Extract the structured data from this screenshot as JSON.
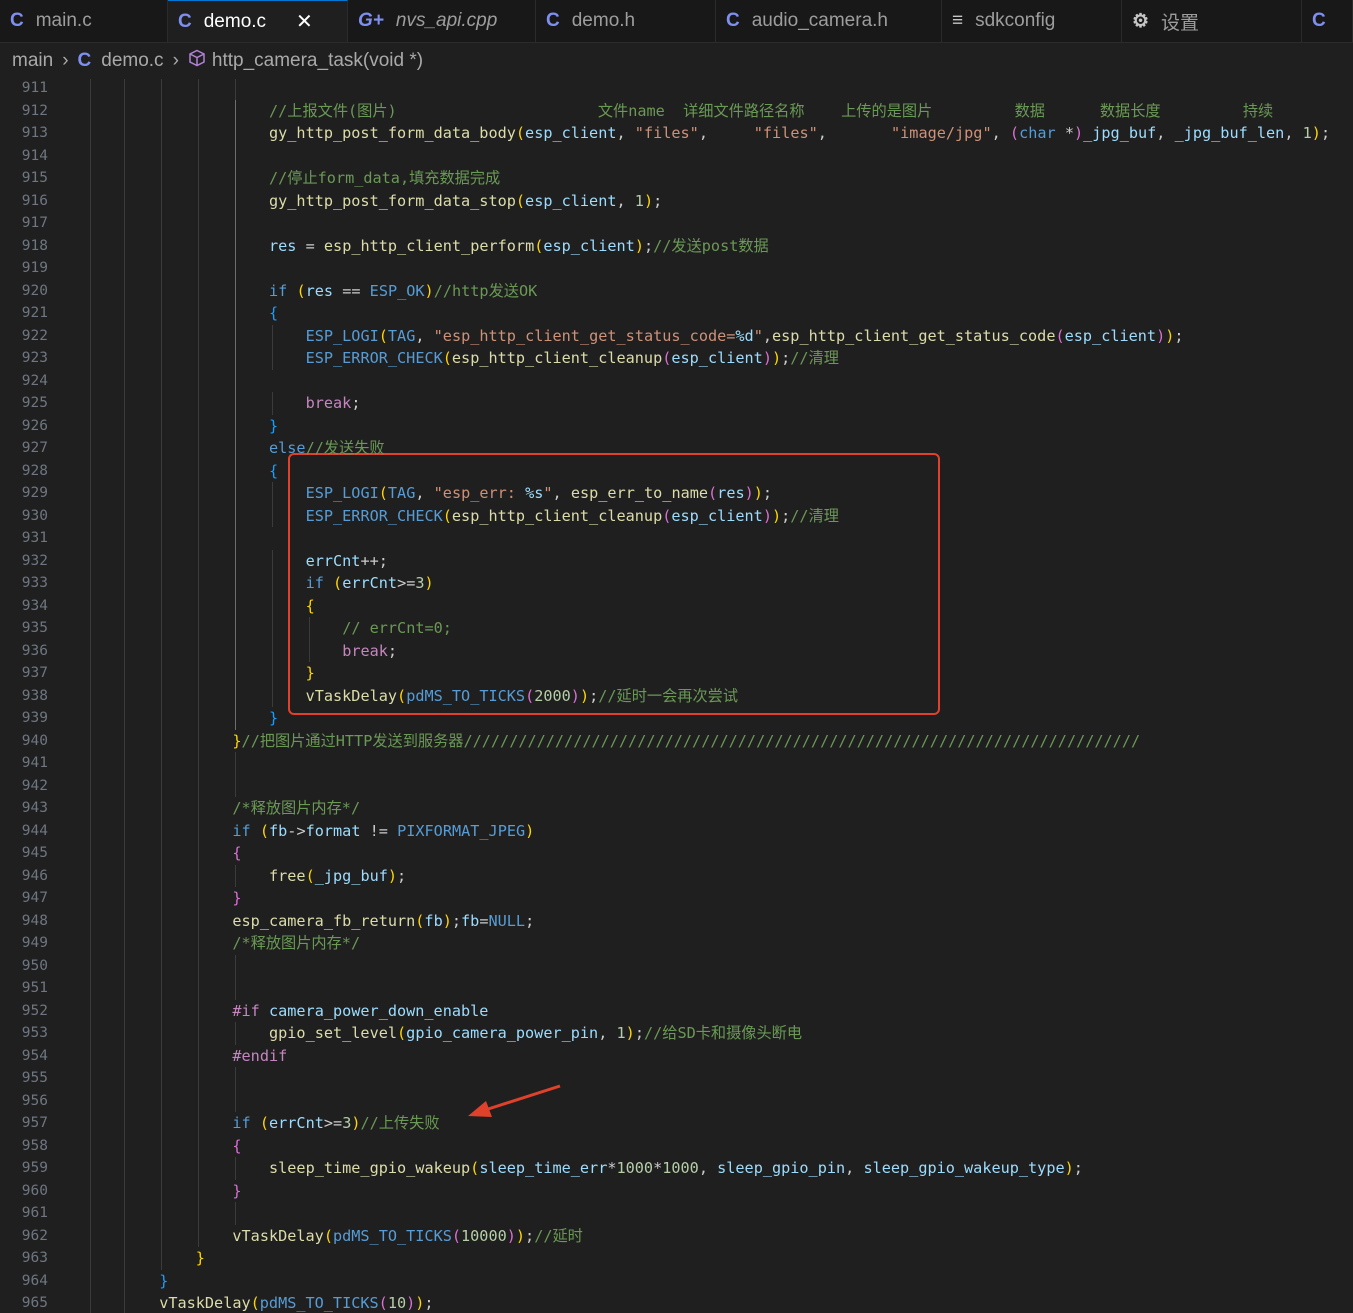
{
  "tabs": [
    {
      "icon": "C",
      "label": "main.c"
    },
    {
      "icon": "C",
      "label": "demo.c"
    },
    {
      "icon": "G+",
      "label": "nvs_api.cpp"
    },
    {
      "icon": "C",
      "label": "demo.h"
    },
    {
      "icon": "C",
      "label": "audio_camera.h"
    },
    {
      "icon": "≡",
      "label": "sdkconfig"
    },
    {
      "icon": "⚙",
      "label": "设置"
    },
    {
      "icon": "C",
      "label": ""
    }
  ],
  "active_tab": "demo.c",
  "breadcrumb": {
    "folder": "main",
    "file": "demo.c",
    "symbol": "http_camera_task(void *)"
  },
  "annotation": {
    "box_color": "#e0412b",
    "arrow_color": "#e0412b"
  },
  "lines": [
    {
      "n": "911",
      "t": ""
    },
    {
      "n": "912",
      "t": "//上报文件(图片)                      文件name  详细文件路径名称    上传的是图片         数据      数据长度         持续"
    },
    {
      "n": "913",
      "t": "gy_http_post_form_data_body(esp_client, \"files\",     \"files\",       \"image/jpg\", (char *)_jpg_buf, _jpg_buf_len, 1);"
    },
    {
      "n": "914",
      "t": ""
    },
    {
      "n": "915",
      "t": "//停止form_data,填充数据完成"
    },
    {
      "n": "916",
      "t": "gy_http_post_form_data_stop(esp_client, 1);"
    },
    {
      "n": "917",
      "t": ""
    },
    {
      "n": "918",
      "t": "res = esp_http_client_perform(esp_client);//发送post数据"
    },
    {
      "n": "919",
      "t": ""
    },
    {
      "n": "920",
      "t": "if (res == ESP_OK)//http发送OK"
    },
    {
      "n": "921",
      "t": "{"
    },
    {
      "n": "922",
      "t": "ESP_LOGI(TAG, \"esp_http_client_get_status_code=%d\",esp_http_client_get_status_code(esp_client));"
    },
    {
      "n": "923",
      "t": "ESP_ERROR_CHECK(esp_http_client_cleanup(esp_client));//清理"
    },
    {
      "n": "924",
      "t": ""
    },
    {
      "n": "925",
      "t": "break;"
    },
    {
      "n": "926",
      "t": "}"
    },
    {
      "n": "927",
      "t": "else//发送失败"
    },
    {
      "n": "928",
      "t": "{"
    },
    {
      "n": "929",
      "t": "ESP_LOGI(TAG, \"esp_err: %s\", esp_err_to_name(res));"
    },
    {
      "n": "930",
      "t": "ESP_ERROR_CHECK(esp_http_client_cleanup(esp_client));//清理"
    },
    {
      "n": "931",
      "t": ""
    },
    {
      "n": "932",
      "t": "errCnt++;"
    },
    {
      "n": "933",
      "t": "if (errCnt>=3)"
    },
    {
      "n": "934",
      "t": "{"
    },
    {
      "n": "935",
      "t": "// errCnt=0;"
    },
    {
      "n": "936",
      "t": "break;"
    },
    {
      "n": "937",
      "t": "}"
    },
    {
      "n": "938",
      "t": "vTaskDelay(pdMS_TO_TICKS(2000));//延时一会再次尝试"
    },
    {
      "n": "939",
      "t": "}"
    },
    {
      "n": "940",
      "t": "}//把图片通过HTTP发送到服务器//////////////////////////////////////////////////////////////////////////"
    },
    {
      "n": "941",
      "t": ""
    },
    {
      "n": "942",
      "t": ""
    },
    {
      "n": "943",
      "t": "/*释放图片内存*/"
    },
    {
      "n": "944",
      "t": "if (fb->format != PIXFORMAT_JPEG)"
    },
    {
      "n": "945",
      "t": "{"
    },
    {
      "n": "946",
      "t": "free(_jpg_buf);"
    },
    {
      "n": "947",
      "t": "}"
    },
    {
      "n": "948",
      "t": "esp_camera_fb_return(fb);fb=NULL;"
    },
    {
      "n": "949",
      "t": "/*释放图片内存*/"
    },
    {
      "n": "950",
      "t": ""
    },
    {
      "n": "951",
      "t": ""
    },
    {
      "n": "952",
      "t": "#if camera_power_down_enable"
    },
    {
      "n": "953",
      "t": "gpio_set_level(gpio_camera_power_pin, 1);//给SD卡和摄像头断电"
    },
    {
      "n": "954",
      "t": "#endif"
    },
    {
      "n": "955",
      "t": ""
    },
    {
      "n": "956",
      "t": ""
    },
    {
      "n": "957",
      "t": "if (errCnt>=3)//上传失败"
    },
    {
      "n": "958",
      "t": "{"
    },
    {
      "n": "959",
      "t": "sleep_time_gpio_wakeup(sleep_time_err*1000*1000, sleep_gpio_pin, sleep_gpio_wakeup_type);"
    },
    {
      "n": "960",
      "t": "}"
    },
    {
      "n": "961",
      "t": ""
    },
    {
      "n": "962",
      "t": "vTaskDelay(pdMS_TO_TICKS(10000));//延时"
    },
    {
      "n": "963",
      "t": "}"
    },
    {
      "n": "964",
      "t": "}"
    },
    {
      "n": "965",
      "t": "vTaskDelay(pdMS_TO_TICKS(10));"
    }
  ]
}
